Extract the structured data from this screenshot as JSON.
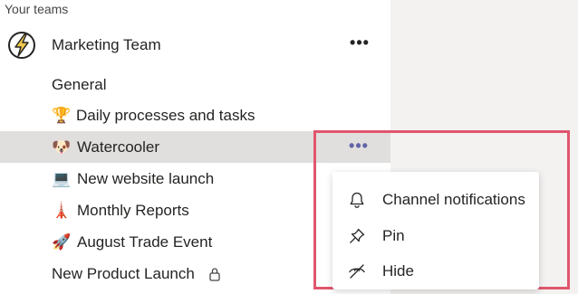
{
  "sidebar": {
    "section_header": "Your teams",
    "team": {
      "name": "Marketing Team",
      "more_label": "•••",
      "avatar_icon": "lightning-bolt-icon"
    },
    "channels": [
      {
        "label": "General",
        "emoji": "",
        "icon": ""
      },
      {
        "label": "Daily processes and tasks",
        "emoji": "🏆",
        "icon": "trophy-icon"
      },
      {
        "label": "Watercooler",
        "emoji": "🐶",
        "icon": "dog-icon",
        "active": true,
        "more_label": "•••"
      },
      {
        "label": "New website launch",
        "emoji": "💻",
        "icon": "laptop-icon"
      },
      {
        "label": "Monthly Reports",
        "emoji": "🗼",
        "icon": "tower-icon"
      },
      {
        "label": "August Trade Event",
        "emoji": "🚀",
        "icon": "rocket-icon"
      },
      {
        "label": "New Product Launch",
        "emoji": "",
        "icon": "",
        "private": true
      }
    ]
  },
  "context_menu": {
    "items": [
      {
        "label": "Channel notifications",
        "icon": "bell-icon"
      },
      {
        "label": "Pin",
        "icon": "pin-icon"
      },
      {
        "label": "Hide",
        "icon": "eye-slash-icon"
      }
    ]
  },
  "colors": {
    "accent": "#6264a7",
    "highlight_border": "#e0566e",
    "active_row": "#e1dfdd",
    "background": "#f3f2f1"
  }
}
